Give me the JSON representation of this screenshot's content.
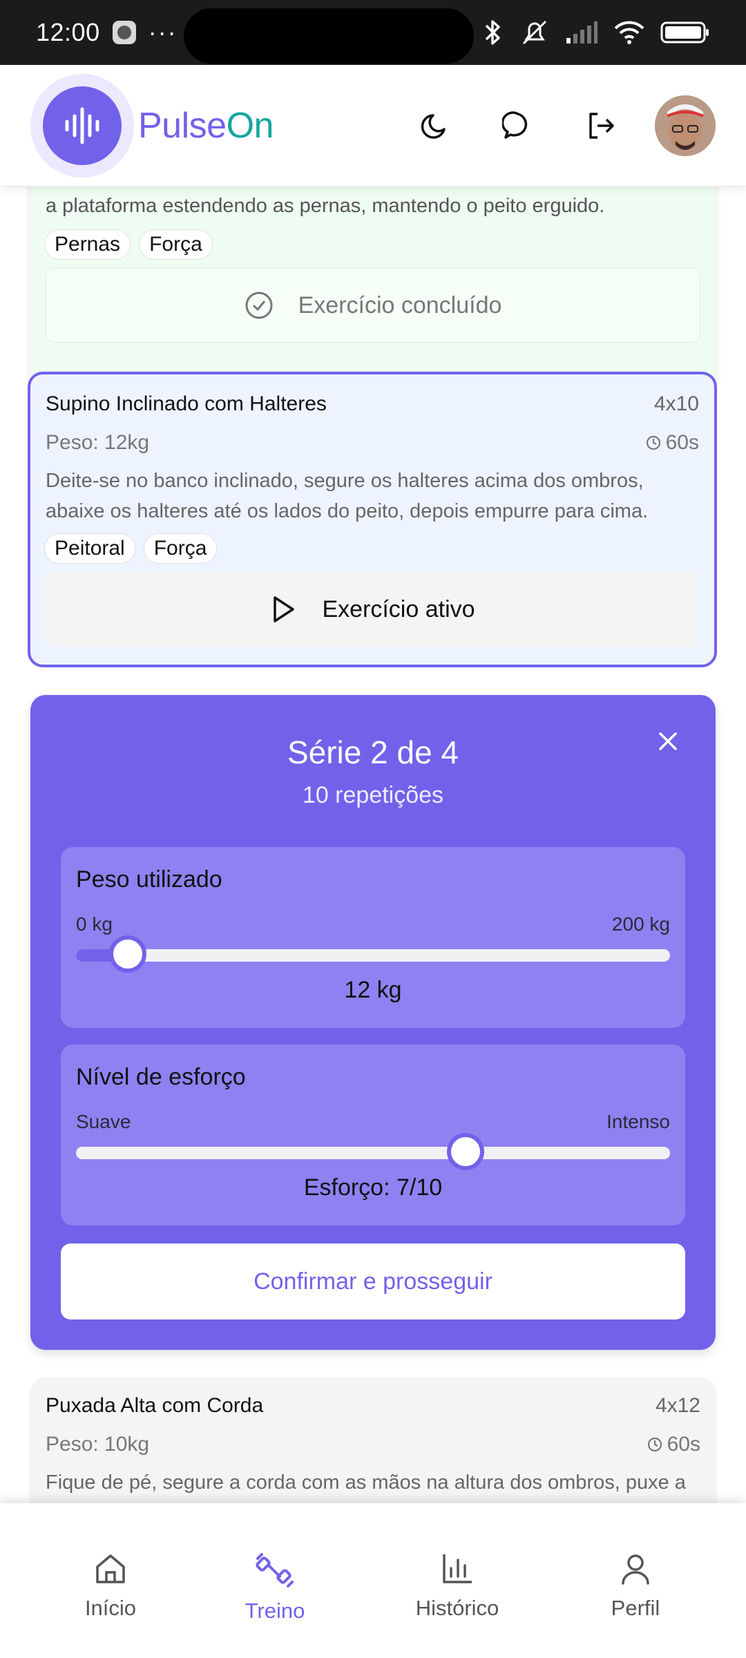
{
  "status_bar": {
    "time": "12:00",
    "more": "···"
  },
  "header": {
    "brand_part1": "Pulse",
    "brand_part2": "On"
  },
  "completed_card": {
    "description_cut": "a plataforma estendendo as pernas, mantendo o peito erguido.",
    "tags": [
      "Pernas",
      "Força"
    ],
    "state_label": "Exercício concluído"
  },
  "active_card": {
    "title": "Supino Inclinado com Halteres",
    "sets": "4x10",
    "weight": "Peso: 12kg",
    "rest": "60s",
    "description": "Deite-se no banco inclinado, segure os halteres acima dos ombros, abaixe os halteres até os lados do peito, depois empurre para cima.",
    "tags": [
      "Peitoral",
      "Força"
    ],
    "state_label": "Exercício ativo"
  },
  "series_panel": {
    "title": "Série 2 de 4",
    "subtitle": "10 repetições",
    "weight": {
      "title": "Peso utilizado",
      "min_label": "0 kg",
      "max_label": "200 kg",
      "min": 0,
      "max": 200,
      "value": 12,
      "value_label": "12 kg"
    },
    "effort": {
      "title": "Nível de esforço",
      "min_label": "Suave",
      "max_label": "Intenso",
      "min": 1,
      "max": 10,
      "value": 7,
      "value_label": "Esforço: 7/10"
    },
    "confirm_label": "Confirmar e prosseguir"
  },
  "next_card": {
    "title": "Puxada Alta com Corda",
    "sets": "4x12",
    "weight": "Peso: 10kg",
    "rest": "60s",
    "description_cut": "Fique de pé, segure a corda com as mãos na altura dos ombros, puxe a"
  },
  "bottom_nav": {
    "items": [
      {
        "label": "Início",
        "icon": "home-icon"
      },
      {
        "label": "Treino",
        "icon": "dumbbell-icon",
        "active": true
      },
      {
        "label": "Histórico",
        "icon": "chart-icon"
      },
      {
        "label": "Perfil",
        "icon": "user-icon"
      }
    ]
  },
  "colors": {
    "accent": "#7262ea",
    "teal": "#14a6a0",
    "done_bg": "#eefcf2",
    "active_bg": "#edf3ff"
  }
}
